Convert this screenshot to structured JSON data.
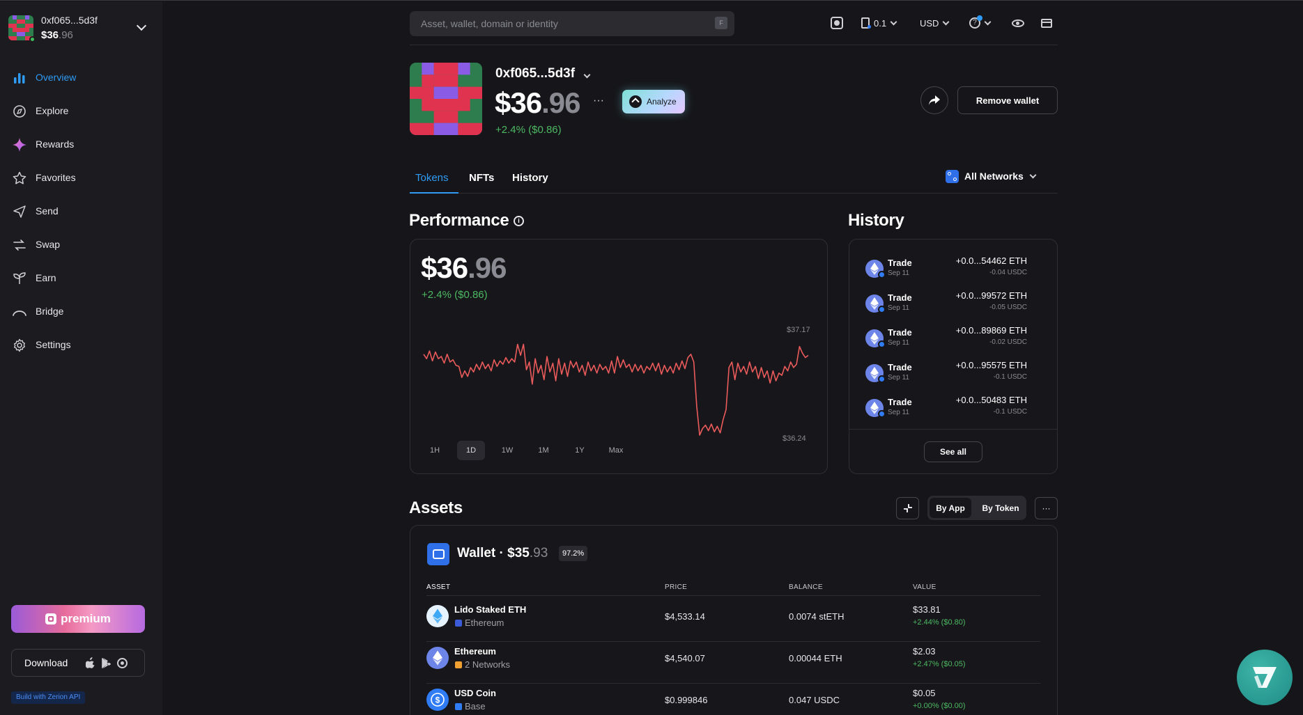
{
  "account": {
    "name": "0xf065...5d3f",
    "balance_main": "$36",
    "balance_decimals": ".96"
  },
  "nav": [
    {
      "label": "Overview",
      "icon": "bar-chart-icon",
      "active": true
    },
    {
      "label": "Explore",
      "icon": "compass-icon"
    },
    {
      "label": "Rewards",
      "icon": "sparkle-icon"
    },
    {
      "label": "Favorites",
      "icon": "star-icon"
    },
    {
      "label": "Send",
      "icon": "send-icon"
    },
    {
      "label": "Swap",
      "icon": "swap-icon"
    },
    {
      "label": "Earn",
      "icon": "sprout-icon"
    },
    {
      "label": "Bridge",
      "icon": "bridge-icon"
    },
    {
      "label": "Settings",
      "icon": "gear-icon"
    }
  ],
  "sidebar_footer": {
    "premium_label": "premium",
    "download_label": "Download",
    "api_label": "Build with Zerion API"
  },
  "topbar": {
    "search_placeholder": "Asset, wallet, domain or identity",
    "search_shortcut": "F",
    "gas_value": "0.1",
    "currency": "USD"
  },
  "wallet": {
    "name": "0xf065...5d3f",
    "value_main": "$36",
    "value_decimals": ".96",
    "more": "···",
    "change": "+2.4% ($0.86)",
    "analyze_label": "Analyze",
    "remove_label": "Remove wallet"
  },
  "tabs": [
    {
      "label": "Tokens",
      "active": true
    },
    {
      "label": "NFTs"
    },
    {
      "label": "History"
    }
  ],
  "network_filter": "All Networks",
  "performance": {
    "title": "Performance",
    "value_main": "$36",
    "value_decimals": ".96",
    "change": "+2.4% ($0.86)",
    "max_label": "$37.17",
    "min_label": "$36.24",
    "ranges": [
      "1H",
      "1D",
      "1W",
      "1M",
      "1Y",
      "Max"
    ],
    "selected_range": "1D"
  },
  "chart_data": {
    "type": "line",
    "title": "",
    "xlabel": "",
    "ylabel": "",
    "ylim": [
      36.24,
      37.17
    ],
    "color": "#ec5b5b",
    "series": [
      {
        "values": [
          36.97,
          36.93,
          37.0,
          36.91,
          36.99,
          36.93,
          36.95,
          36.89,
          36.97,
          36.9,
          36.92,
          36.87,
          36.86,
          36.76,
          36.82,
          36.77,
          36.85,
          36.81,
          36.88,
          36.83,
          36.9,
          36.84,
          36.88,
          36.82,
          36.92,
          36.86,
          36.91,
          36.88,
          36.94,
          36.89,
          36.93,
          36.9,
          37.06,
          36.96,
          37.06,
          36.83,
          36.9,
          36.7,
          36.93,
          36.8,
          36.87,
          36.74,
          36.95,
          36.81,
          36.89,
          36.73,
          36.93,
          36.79,
          36.89,
          36.77,
          36.91,
          36.85,
          36.9,
          36.81,
          36.87,
          36.78,
          36.9,
          36.82,
          36.87,
          36.8,
          36.88,
          36.83,
          36.86,
          36.8,
          36.91,
          36.8,
          36.95,
          36.85,
          36.92,
          36.85,
          36.88,
          36.81,
          36.88,
          36.82,
          36.87,
          36.8,
          36.86,
          36.83,
          36.89,
          36.82,
          36.89,
          36.79,
          36.87,
          36.81,
          36.86,
          36.8,
          36.89,
          36.83,
          36.91,
          36.84,
          36.94,
          36.97,
          36.9,
          36.5,
          36.24,
          36.3,
          36.33,
          36.28,
          36.34,
          36.27,
          36.32,
          36.26,
          36.38,
          36.47,
          36.85,
          36.9,
          36.74,
          36.89,
          36.81,
          36.86,
          36.79,
          36.9,
          36.81,
          36.86,
          36.75,
          36.85,
          36.76,
          36.82,
          36.71,
          36.82,
          36.73,
          36.8,
          36.78,
          36.86,
          36.82,
          36.9,
          36.85,
          36.88,
          37.04,
          36.98,
          36.94,
          36.96
        ]
      }
    ]
  },
  "history": {
    "title": "History",
    "see_all": "See all",
    "items": [
      {
        "type": "Trade",
        "date": "Sep 11",
        "amount": "+0.0...54462 ETH",
        "sub": "-0.04 USDC"
      },
      {
        "type": "Trade",
        "date": "Sep 11",
        "amount": "+0.0...99572 ETH",
        "sub": "-0.05 USDC"
      },
      {
        "type": "Trade",
        "date": "Sep 11",
        "amount": "+0.0...89869 ETH",
        "sub": "-0.02 USDC"
      },
      {
        "type": "Trade",
        "date": "Sep 11",
        "amount": "+0.0...95575 ETH",
        "sub": "-0.1 USDC"
      },
      {
        "type": "Trade",
        "date": "Sep 11",
        "amount": "+0.0...50483 ETH",
        "sub": "-0.1 USDC"
      }
    ]
  },
  "assets": {
    "title": "Assets",
    "by_app": "By App",
    "by_token": "By Token",
    "more": "···",
    "wallet_label": "Wallet · $35",
    "wallet_decimals": ".93",
    "wallet_pct": "97.2%",
    "columns": [
      "ASSET",
      "PRICE",
      "BALANCE",
      "VALUE"
    ],
    "rows": [
      {
        "name": "Lido Staked ETH",
        "network": "Ethereum",
        "price": "$4,533.14",
        "balance": "0.0074 stETH",
        "value": "$33.81",
        "change": "+2.44% ($0.80)",
        "icon": "steth-icon"
      },
      {
        "name": "Ethereum",
        "network": "2 Networks",
        "price": "$4,540.07",
        "balance": "0.00044 ETH",
        "value": "$2.03",
        "change": "+2.47% ($0.05)",
        "icon": "eth-icon"
      },
      {
        "name": "USD Coin",
        "network": "Base",
        "price": "$0.999846",
        "balance": "0.047 USDC",
        "value": "$0.05",
        "change": "+0.00% ($0.00)",
        "icon": "usdc-icon"
      }
    ]
  }
}
